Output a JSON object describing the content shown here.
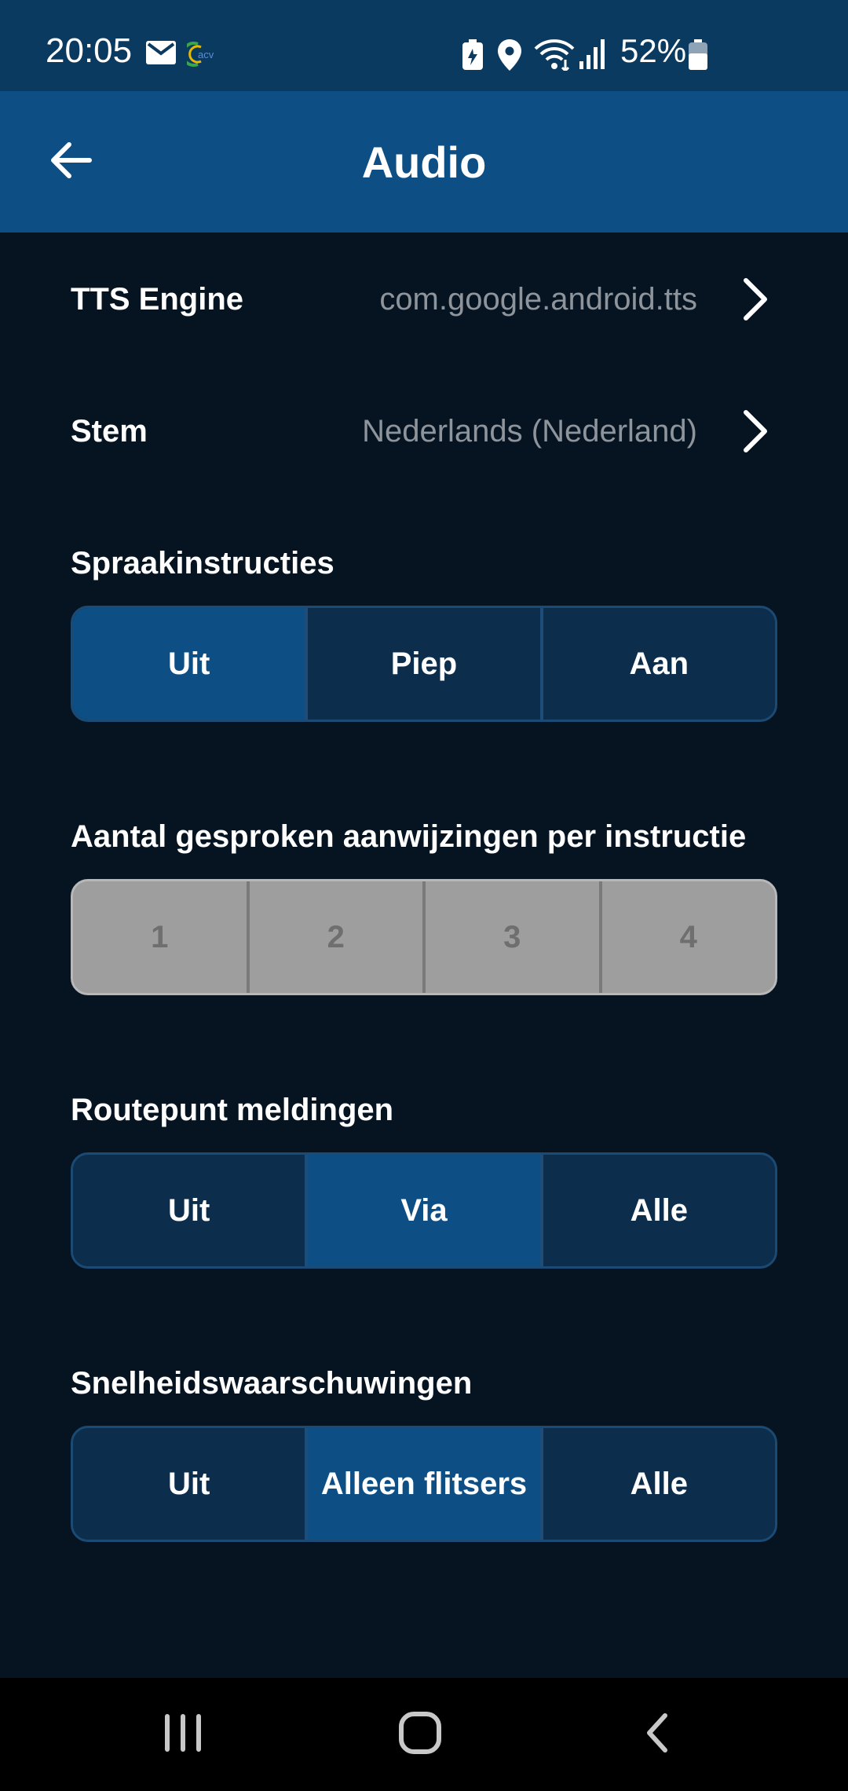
{
  "status_bar": {
    "time": "20:05",
    "battery_percent": "52%",
    "icons": [
      "mail-icon",
      "acv-app-icon",
      "battery-saver-icon",
      "location-icon",
      "wifi-icon",
      "signal-icon",
      "battery-icon"
    ]
  },
  "app_bar": {
    "title": "Audio",
    "back_icon": "arrow-left-icon"
  },
  "rows": {
    "tts_engine": {
      "label": "TTS Engine",
      "value": "com.google.android.tts"
    },
    "voice": {
      "label": "Stem",
      "value": "Nederlands (Nederland)"
    }
  },
  "sections": {
    "voice_instructions": {
      "title": "Spraakinstructies",
      "options": [
        "Uit",
        "Piep",
        "Aan"
      ],
      "selected": "Uit"
    },
    "spoken_count": {
      "title": "Aantal gesproken aanwijzingen per instructie",
      "options": [
        "1",
        "2",
        "3",
        "4"
      ],
      "disabled": true
    },
    "waypoint_notifications": {
      "title": "Routepunt meldingen",
      "options": [
        "Uit",
        "Via",
        "Alle"
      ],
      "selected": "Via"
    },
    "speed_warnings": {
      "title": "Snelheidswaarschuwingen",
      "options": [
        "Uit",
        "Alleen flitsers",
        "Alle"
      ],
      "selected": "Alleen flitsers"
    }
  },
  "nav_bar": {
    "icons": [
      "recent-apps-icon",
      "home-icon",
      "back-icon"
    ]
  },
  "colors": {
    "status_bar": "#0b3a60",
    "app_bar": "#0d4f84",
    "background": "#061422",
    "segment_inactive": "#0c2e4c",
    "segment_active": "#0d4f84",
    "segment_disabled": "#9e9e9e"
  }
}
